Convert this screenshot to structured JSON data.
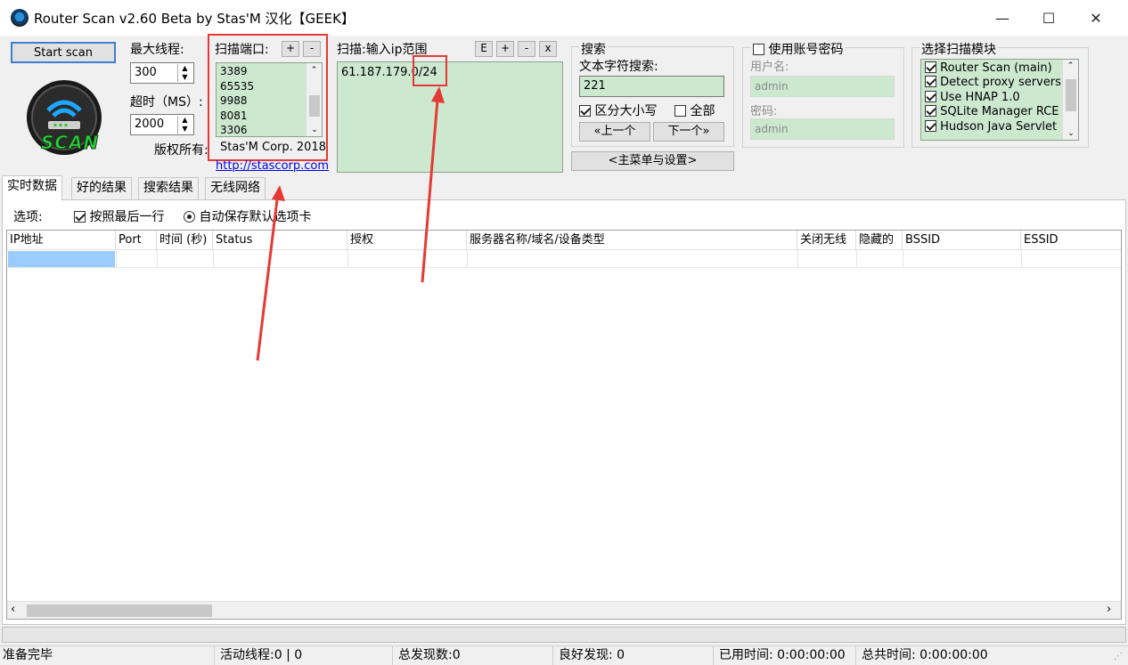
{
  "window": {
    "title": "Router Scan v2.60 Beta by Stas'M  汉化【GEEK】",
    "minimize": "—",
    "maximize": "☐",
    "close": "✕"
  },
  "controls": {
    "start_scan": "Start scan",
    "threads_label": "最大线程:",
    "threads_value": "300",
    "timeout_label": "超时（MS）:",
    "timeout_value": "2000",
    "logo_text": "SCAN",
    "copyright_label": "版权所有:",
    "copyright_value": "Stas'M Corp. 2018",
    "link": "http://stascorp.com"
  },
  "ports": {
    "label": "扫描端口:",
    "add": "+",
    "remove": "-",
    "items": [
      "3389",
      "65535",
      "9988",
      "8081",
      "3306"
    ]
  },
  "ip_range": {
    "label": "扫描:输入ip范围",
    "btn_e": "E",
    "btn_add": "+",
    "btn_remove": "-",
    "btn_x": "x",
    "value": "61.187.179.0/24"
  },
  "search": {
    "group_title": "搜索",
    "text_label": "文本字符搜索:",
    "text_value": "221",
    "case_label": "区分大小写",
    "all_label": "全部",
    "prev": "«上一个",
    "next": "下一个»",
    "menu": "<主菜单与设置>"
  },
  "credentials": {
    "use_label": "使用账号密码",
    "user_label": "用户名:",
    "user_value": "admin",
    "pass_label": "密码:",
    "pass_value": "admin"
  },
  "modules": {
    "title": "选择扫描模块",
    "items": [
      "Router Scan (main)",
      "Detect proxy servers",
      "Use HNAP 1.0",
      "SQLite Manager RCE",
      "Hudson Java Servlet"
    ]
  },
  "tabs": [
    "实时数据",
    "好的结果",
    "搜索结果",
    "无线网络"
  ],
  "options": {
    "label": "选项:",
    "follow_label": "按照最后一行",
    "autosave_label": "自动保存默认选项卡"
  },
  "table": {
    "columns": [
      "IP地址",
      "Port",
      "时间 (秒)",
      "Status",
      "授权",
      "服务器名称/域名/设备类型",
      "关闭无线",
      "隐藏的",
      "BSSID",
      "ESSID"
    ]
  },
  "statusbar": {
    "state": "准备完毕",
    "threads": "活动线程:0 | 0",
    "total": "总发现数:0",
    "good": "良好发现:  0",
    "elapsed": "已用时间: 0:00:00:00",
    "total_time": "总共时间: 0:00:00:00"
  },
  "colors": {
    "annotation_red": "#e53935",
    "field_green": "#cce8cf",
    "selection_blue": "#99ccff",
    "link_blue": "#0000ee"
  }
}
